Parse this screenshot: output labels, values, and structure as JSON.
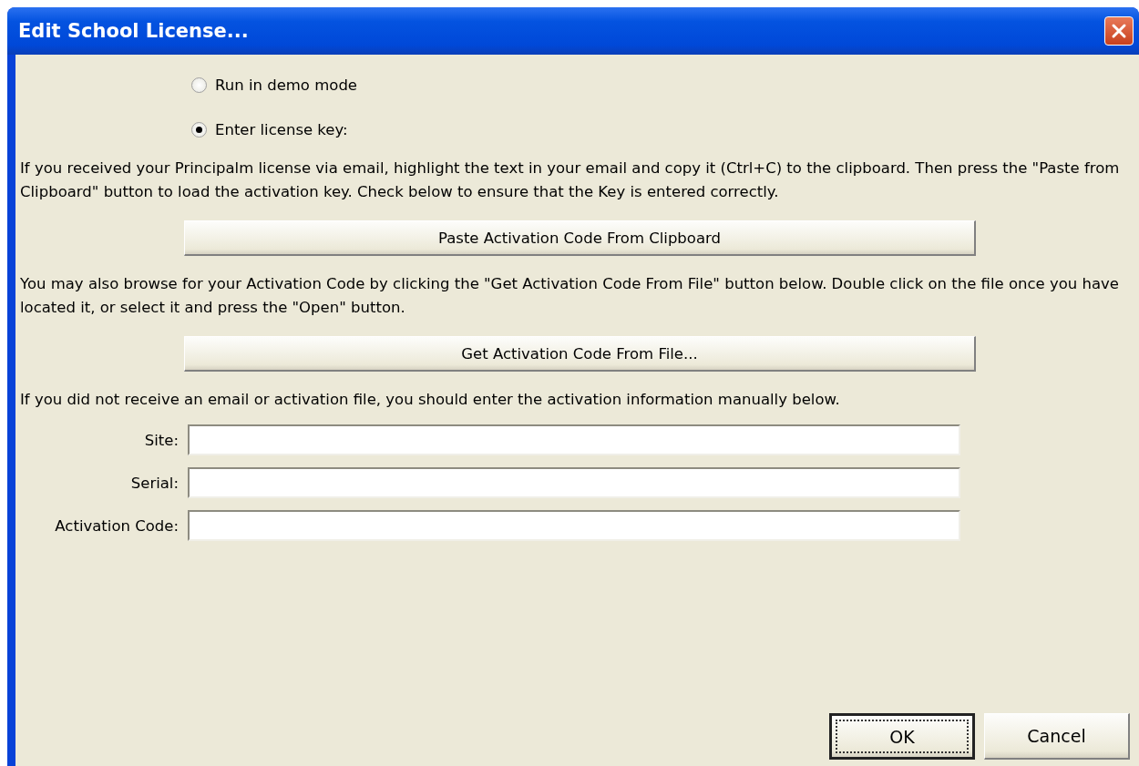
{
  "window": {
    "title": "Edit School License..."
  },
  "mode_options": [
    {
      "label": "Run in demo mode",
      "selected": false
    },
    {
      "label": "Enter license key:",
      "selected": true
    }
  ],
  "sections": [
    {
      "kind": "text",
      "text": "If you received your Principalm license via email, highlight the text in your email and copy it (Ctrl+C) to the clipboard.  Then press the \"Paste from Clipboard\" button to load the activation key.  Check below to ensure that the Key is entered correctly."
    },
    {
      "kind": "button",
      "label": "Paste Activation Code From Clipboard"
    },
    {
      "kind": "text",
      "text": "You may also browse for your Activation Code by clicking the \"Get Activation Code From File\" button below.  Double click on the file once you have located it, or select it and press the \"Open\" button."
    },
    {
      "kind": "button",
      "label": "Get Activation Code From File..."
    },
    {
      "kind": "text",
      "text": "If you did not receive an email or activation file, you should enter the activation information manually below."
    }
  ],
  "fields": [
    {
      "label": "Site:"
    },
    {
      "label": "Serial:"
    },
    {
      "label": "Activation Code:"
    }
  ],
  "dialog_buttons": [
    {
      "label": "OK",
      "default": true
    },
    {
      "label": "Cancel",
      "default": false
    }
  ]
}
